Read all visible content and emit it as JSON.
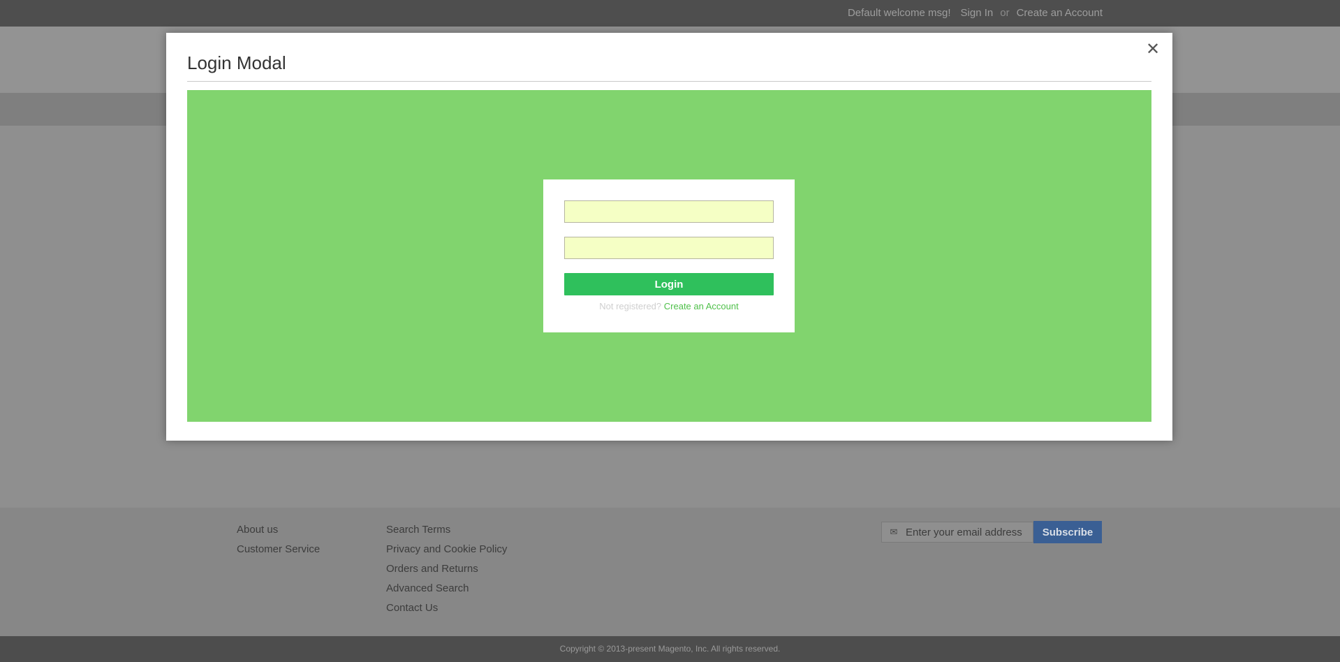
{
  "top_bar": {
    "welcome": "Default welcome msg!",
    "sign_in": "Sign In",
    "or": "or",
    "create_account": "Create an Account"
  },
  "modal": {
    "title": "Login Modal",
    "close_icon": "close-icon",
    "form": {
      "username_value": "",
      "password_value": "",
      "login_label": "Login",
      "not_registered": "Not registered?",
      "create_account": "Create an Account"
    }
  },
  "footer": {
    "col1": [
      "About us",
      "Customer Service"
    ],
    "col2": [
      "Search Terms",
      "Privacy and Cookie Policy",
      "Orders and Returns",
      "Advanced Search",
      "Contact Us"
    ],
    "newsletter": {
      "icon": "envelope-icon",
      "placeholder": "Enter your email address",
      "subscribe_label": "Subscribe"
    },
    "copyright": "Copyright © 2013-present Magento, Inc. All rights reserved."
  },
  "colors": {
    "modal_content_bg": "#81d46e",
    "login_button": "#2fc05c",
    "input_bg": "#f5ffc5",
    "subscribe_button": "#3a5f94"
  }
}
